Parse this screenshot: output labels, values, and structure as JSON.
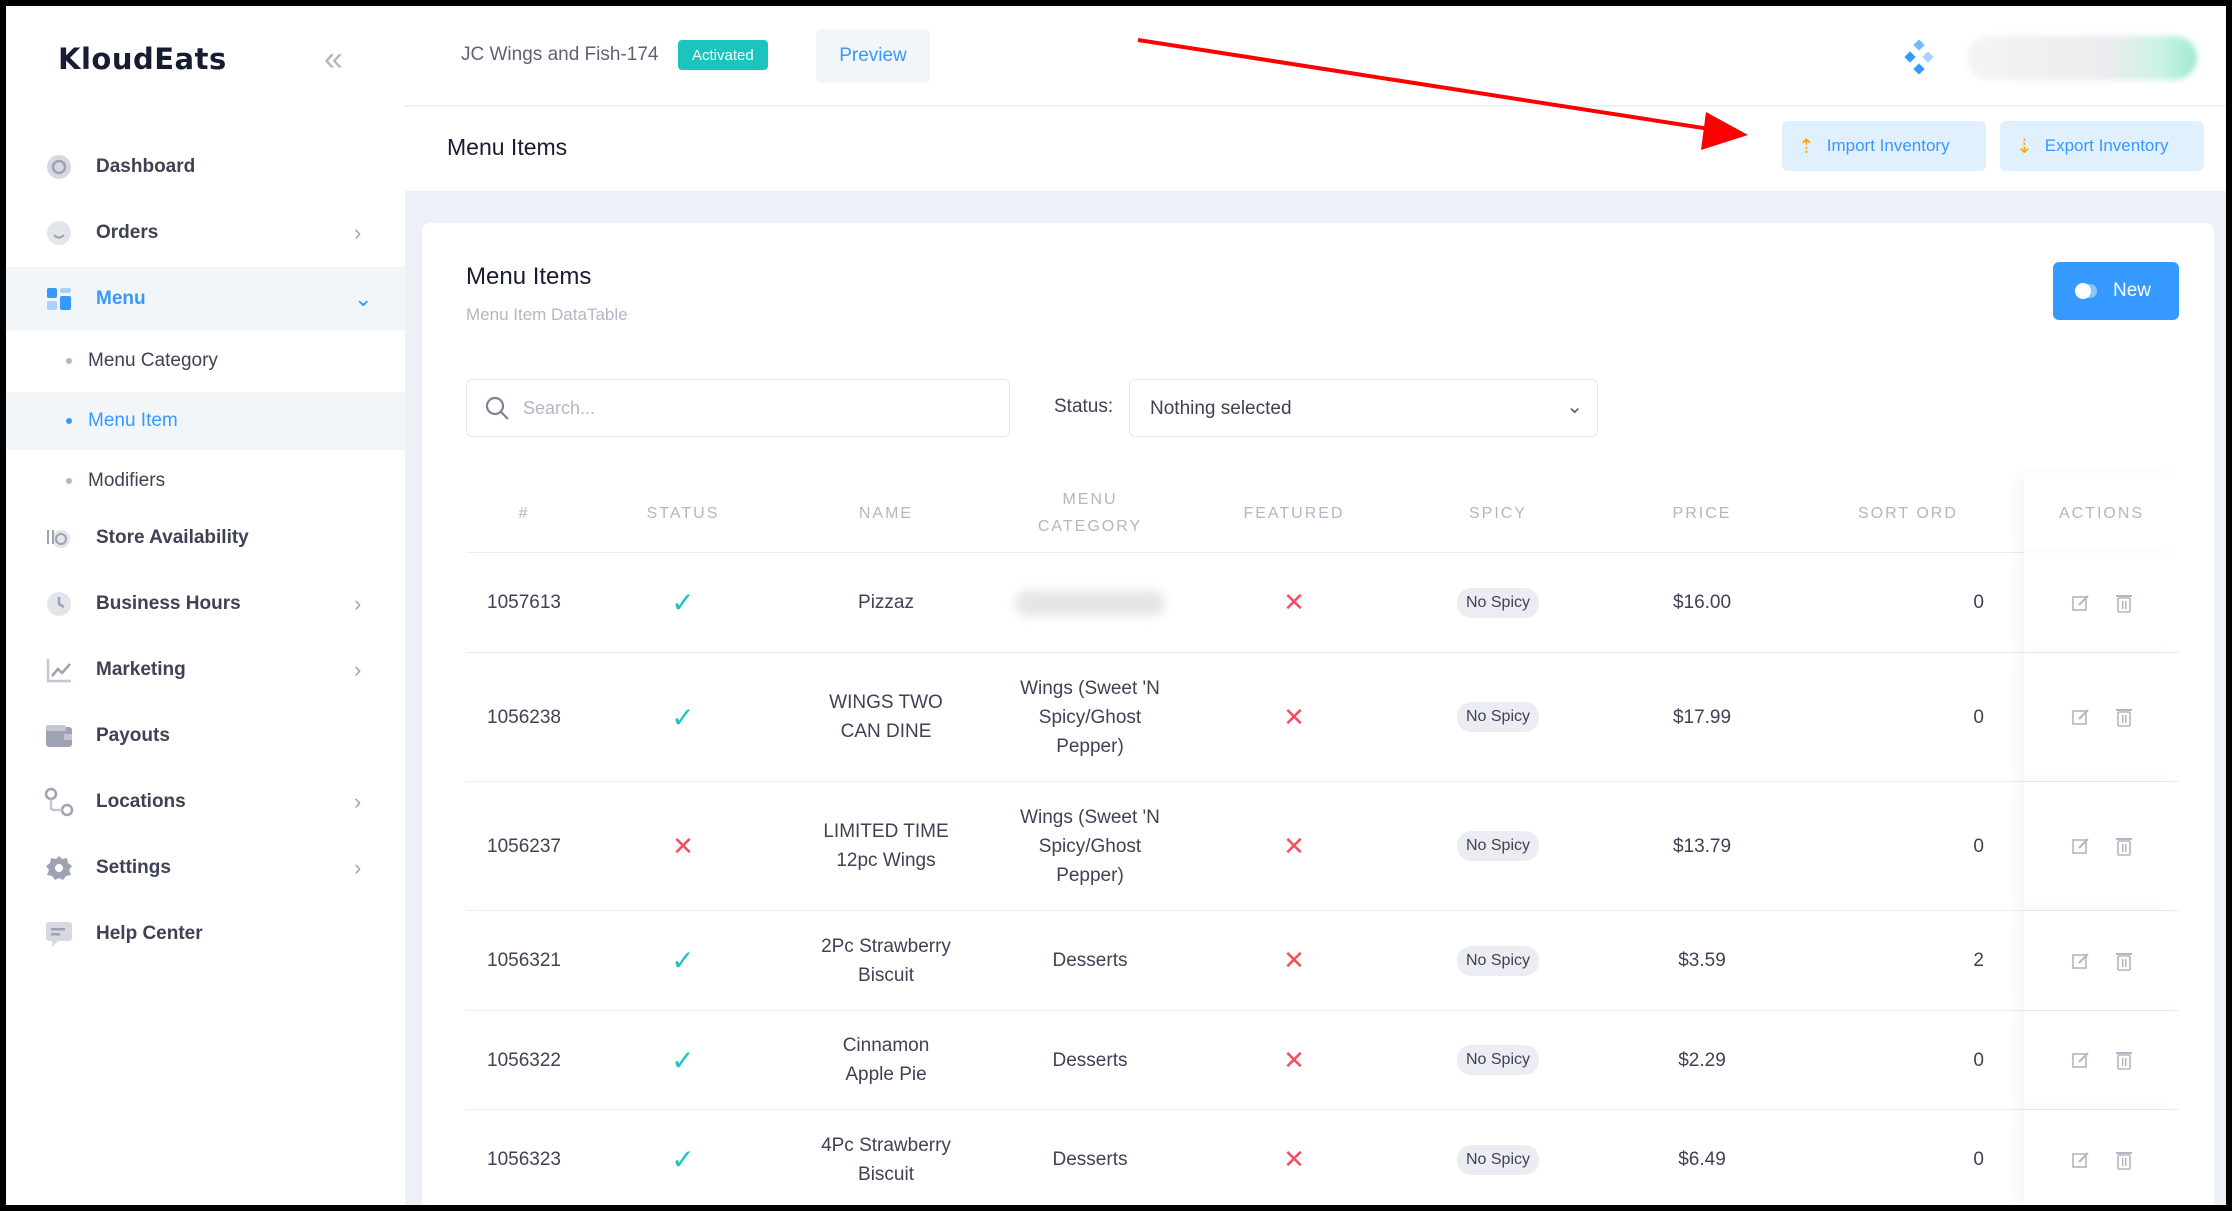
{
  "sidebar": {
    "brand": "KloudEats",
    "items": [
      {
        "label": "Dashboard",
        "icon": "dashboard-icon"
      },
      {
        "label": "Orders",
        "icon": "orders-icon"
      },
      {
        "label": "Menu",
        "icon": "menu-icon",
        "active": true
      },
      {
        "label": "Store Availability",
        "icon": "store-icon"
      },
      {
        "label": "Business Hours",
        "icon": "clock-icon"
      },
      {
        "label": "Marketing",
        "icon": "chart-icon"
      },
      {
        "label": "Payouts",
        "icon": "wallet-icon"
      },
      {
        "label": "Locations",
        "icon": "location-icon"
      },
      {
        "label": "Settings",
        "icon": "gear-icon"
      },
      {
        "label": "Help Center",
        "icon": "chat-icon"
      }
    ],
    "sub_items": [
      {
        "label": "Menu Category"
      },
      {
        "label": "Menu Item",
        "active": true
      },
      {
        "label": "Modifiers"
      }
    ]
  },
  "header": {
    "store_name": "JC Wings and Fish-174",
    "status_badge": "Activated",
    "preview_label": "Preview"
  },
  "subheader": {
    "title": "Menu Items",
    "import_label": "Import Inventory",
    "export_label": "Export Inventory"
  },
  "card": {
    "title": "Menu Items",
    "subtitle": "Menu Item DataTable",
    "new_label": "New",
    "search_placeholder": "Search...",
    "status_label": "Status:",
    "status_value": "Nothing selected"
  },
  "table": {
    "columns": [
      "#",
      "STATUS",
      "NAME",
      "MENU CATEGORY",
      "FEATURED",
      "SPICY",
      "PRICE",
      "SORT ORD",
      "ACTIONS"
    ],
    "rows": [
      {
        "id": "1057613",
        "status": "active",
        "name": "Pizzaz",
        "category": "",
        "featured": "no",
        "spicy": "No Spicy",
        "price": "$16.00",
        "sort": "0"
      },
      {
        "id": "1056238",
        "status": "active",
        "name": "WINGS TWO CAN DINE",
        "category": "Wings (Sweet 'N Spicy/Ghost Pepper)",
        "featured": "no",
        "spicy": "No Spicy",
        "price": "$17.99",
        "sort": "0"
      },
      {
        "id": "1056237",
        "status": "inactive",
        "name": "LIMITED TIME 12pc Wings",
        "category": "Wings (Sweet 'N Spicy/Ghost Pepper)",
        "featured": "no",
        "spicy": "No Spicy",
        "price": "$13.79",
        "sort": "0"
      },
      {
        "id": "1056321",
        "status": "active",
        "name": "2Pc Strawberry Biscuit",
        "category": "Desserts",
        "featured": "no",
        "spicy": "No Spicy",
        "price": "$3.59",
        "sort": "2"
      },
      {
        "id": "1056322",
        "status": "active",
        "name": "Cinnamon Apple Pie",
        "category": "Desserts",
        "featured": "no",
        "spicy": "No Spicy",
        "price": "$2.29",
        "sort": "0"
      },
      {
        "id": "1056323",
        "status": "active",
        "name": "4Pc Strawberry Biscuit",
        "category": "Desserts",
        "featured": "no",
        "spicy": "No Spicy",
        "price": "$6.49",
        "sort": "0"
      }
    ]
  },
  "colors": {
    "accent": "#3699ff",
    "success": "#1bc5bd",
    "danger": "#f64e60",
    "annotation_arrow": "#ff0000"
  }
}
